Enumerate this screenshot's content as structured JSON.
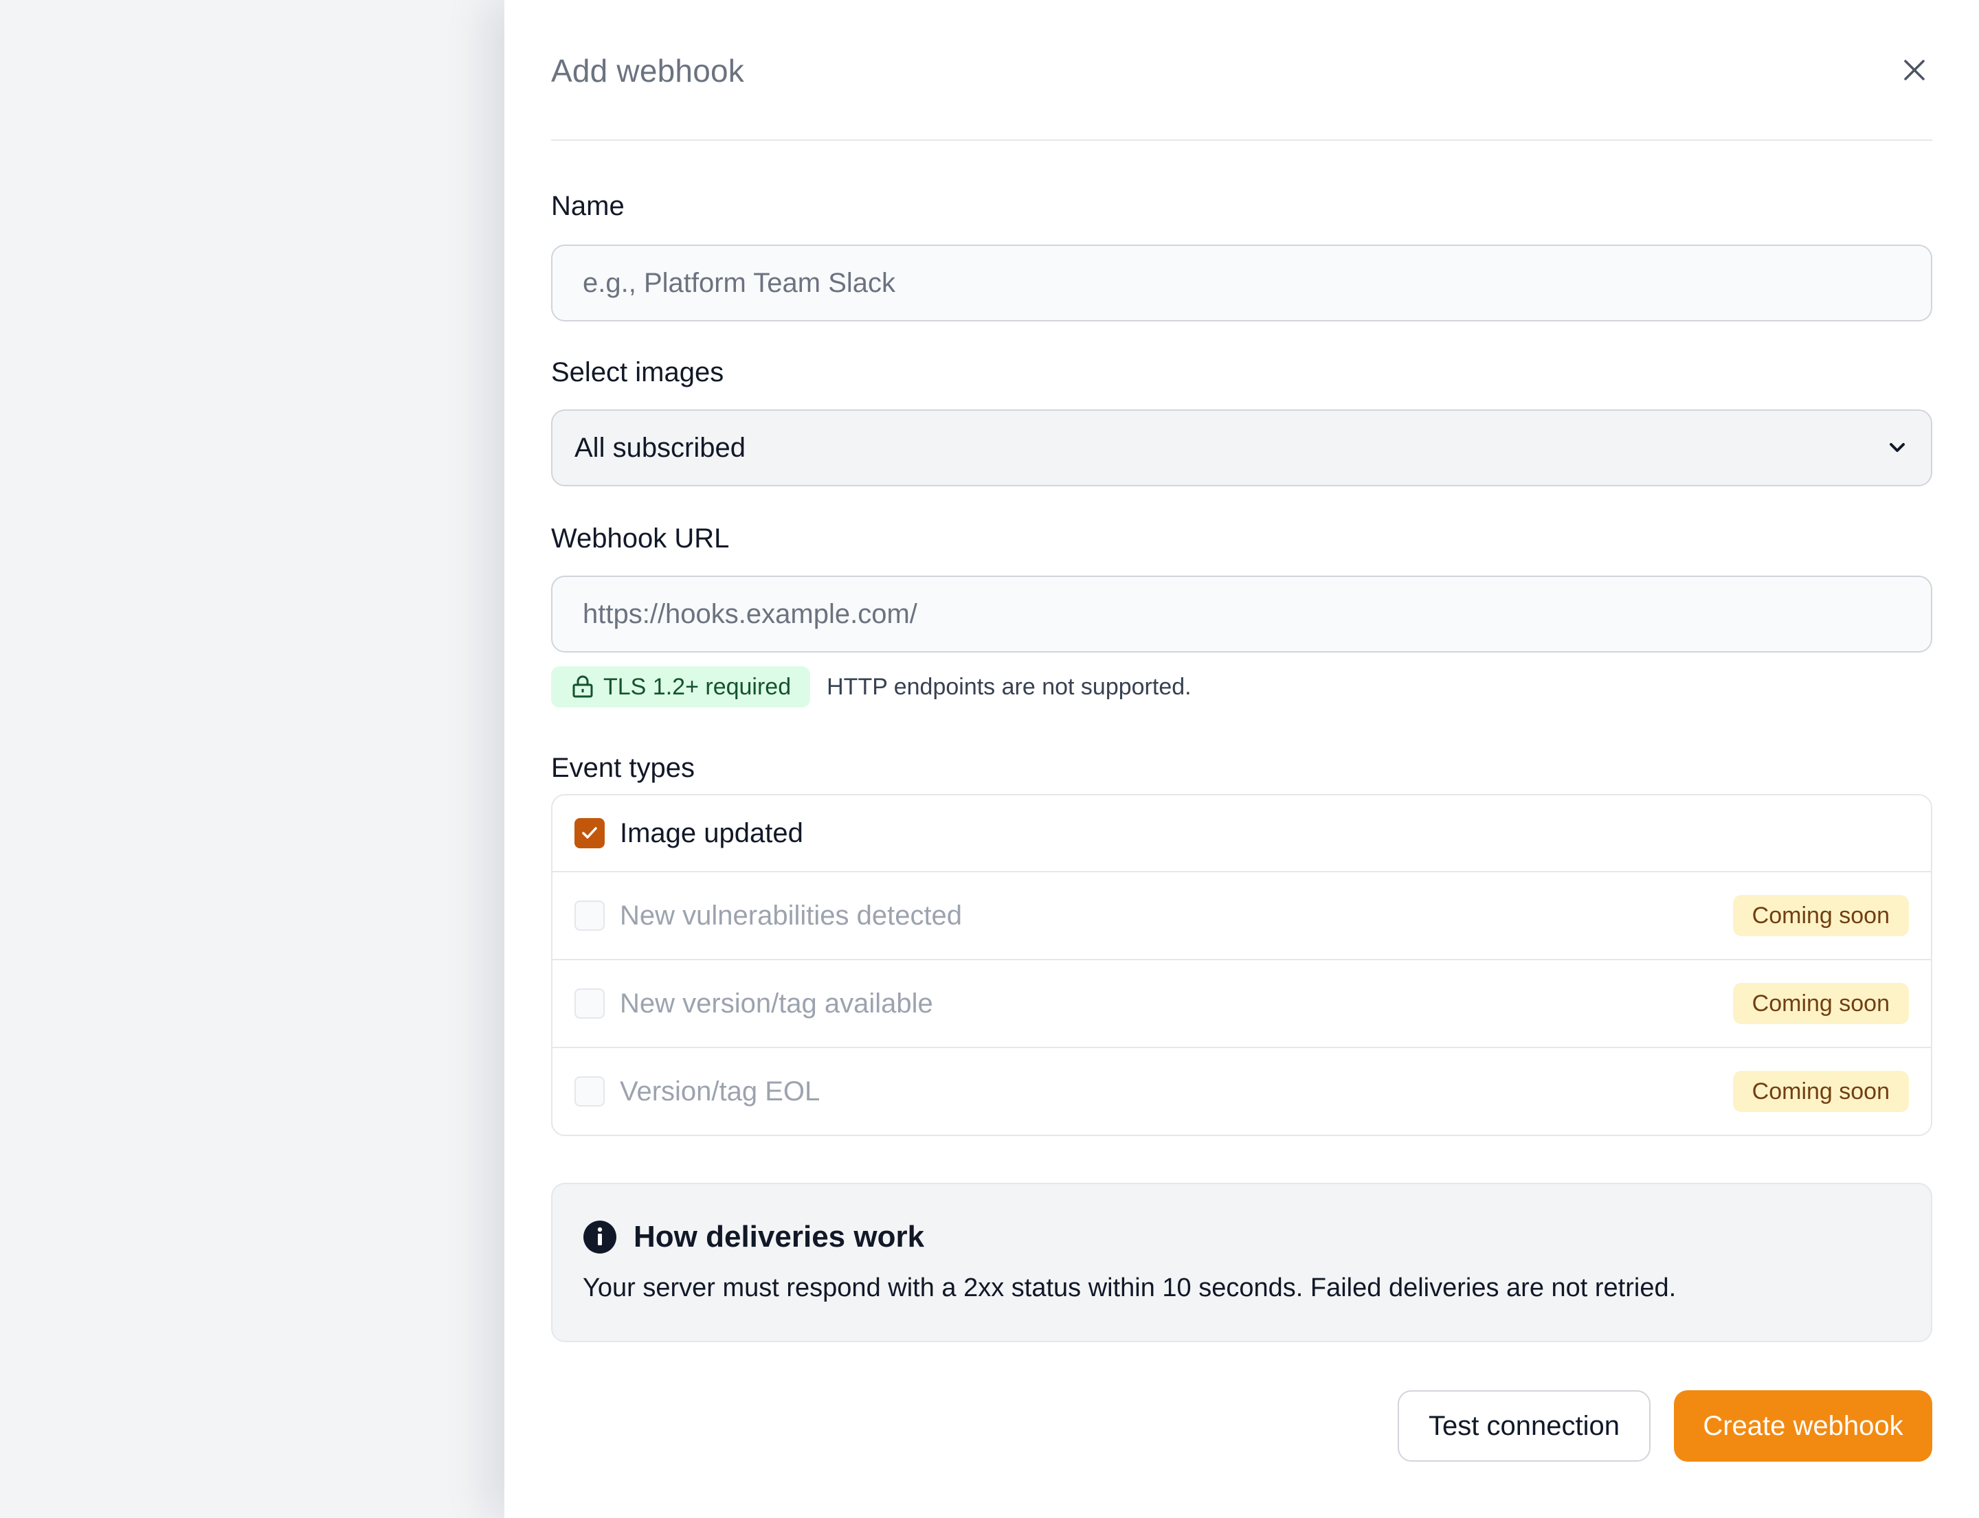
{
  "drawer": {
    "title": "Add webhook"
  },
  "form": {
    "name": {
      "label": "Name",
      "placeholder": "e.g., Platform Team Slack",
      "value": ""
    },
    "images": {
      "label": "Select images",
      "selected": "All subscribed"
    },
    "url": {
      "label": "Webhook URL",
      "placeholder": "https://hooks.example.com/",
      "value": ""
    },
    "tls": {
      "badge": "TLS 1.2+ required",
      "note": "HTTP endpoints are not supported."
    },
    "events": {
      "label": "Event types",
      "items": [
        {
          "label": "Image updated",
          "checked": true,
          "badge": ""
        },
        {
          "label": "New vulnerabilities detected",
          "checked": false,
          "badge": "Coming soon"
        },
        {
          "label": "New version/tag available",
          "checked": false,
          "badge": "Coming soon"
        },
        {
          "label": "Version/tag EOL",
          "checked": false,
          "badge": "Coming soon"
        }
      ]
    }
  },
  "info": {
    "title": "How deliveries work",
    "body": "Your server must respond with a 2xx status within 10 seconds. Failed deliveries are not retried."
  },
  "actions": {
    "test_label": "Test connection",
    "create_label": "Create webhook"
  },
  "colors": {
    "accent": "#f28a12",
    "checkbox": "#c2570c",
    "tls_bg": "#dcfce7",
    "soon_bg": "#fef3c7"
  },
  "icons": {
    "close": "close-icon",
    "dropdown": "chevron-down-icon",
    "tls": "lock-icon",
    "check": "check-icon",
    "info": "info-icon"
  }
}
